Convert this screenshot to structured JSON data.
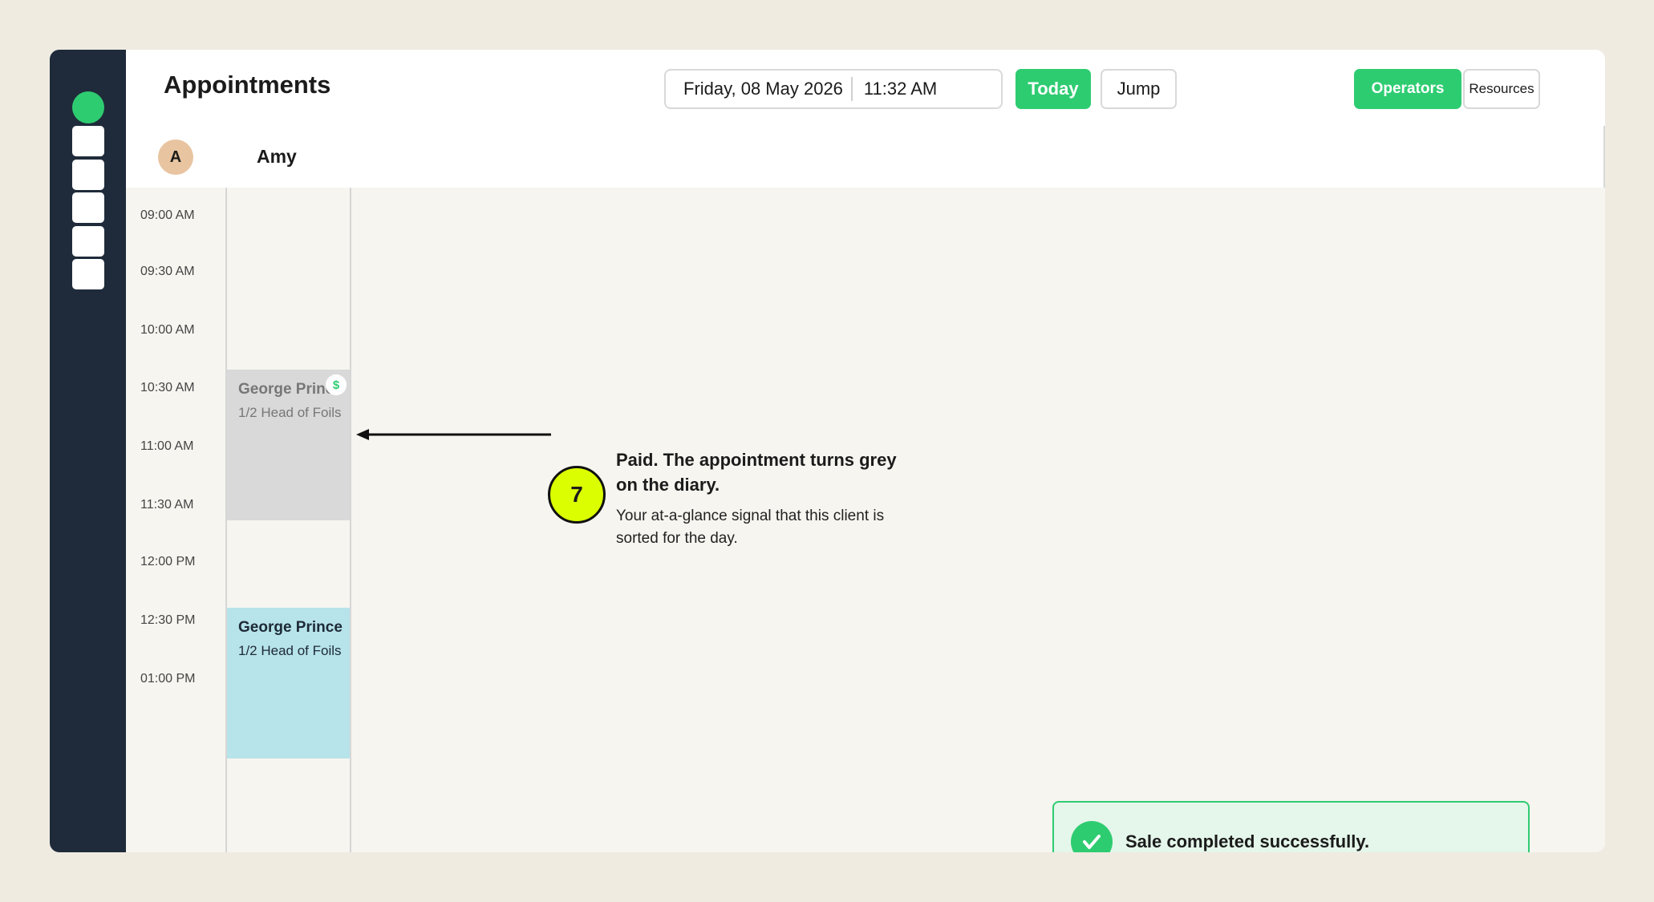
{
  "header": {
    "title": "Appointments",
    "date": "Friday, 08 May 2026",
    "time": "11:32 AM",
    "today_label": "Today",
    "jump_label": "Jump",
    "view_toggle": {
      "operators_label": "Operators",
      "resources_label": "Resources",
      "selected": "Operators"
    }
  },
  "operator": {
    "initial": "A",
    "name": "Amy"
  },
  "time_slots": [
    "09:00 AM",
    "09:30 AM",
    "10:00 AM",
    "10:30 AM",
    "11:00 AM",
    "11:30 AM",
    "12:00 PM",
    "12:30 PM",
    "01:00 PM"
  ],
  "appointments": [
    {
      "client": "George Prince",
      "service": "1/2 Head of Foils",
      "status": "paid",
      "badge": "$"
    },
    {
      "client": "George Prince",
      "service": "1/2 Head of Foils",
      "status": "booked"
    }
  ],
  "callout": {
    "step": "7",
    "title": "Paid. The appointment turns grey on the diary.",
    "body": "Your at-a-glance signal that this client is sorted for the day."
  },
  "toast": {
    "message": "Sale completed successfully."
  },
  "colors": {
    "accent": "#2ecc71",
    "sidebar": "#1f2b3a",
    "paid_appointment": "#d9d9d9",
    "booked_appointment": "#b7e3ea",
    "step_marker": "#dbff00"
  }
}
